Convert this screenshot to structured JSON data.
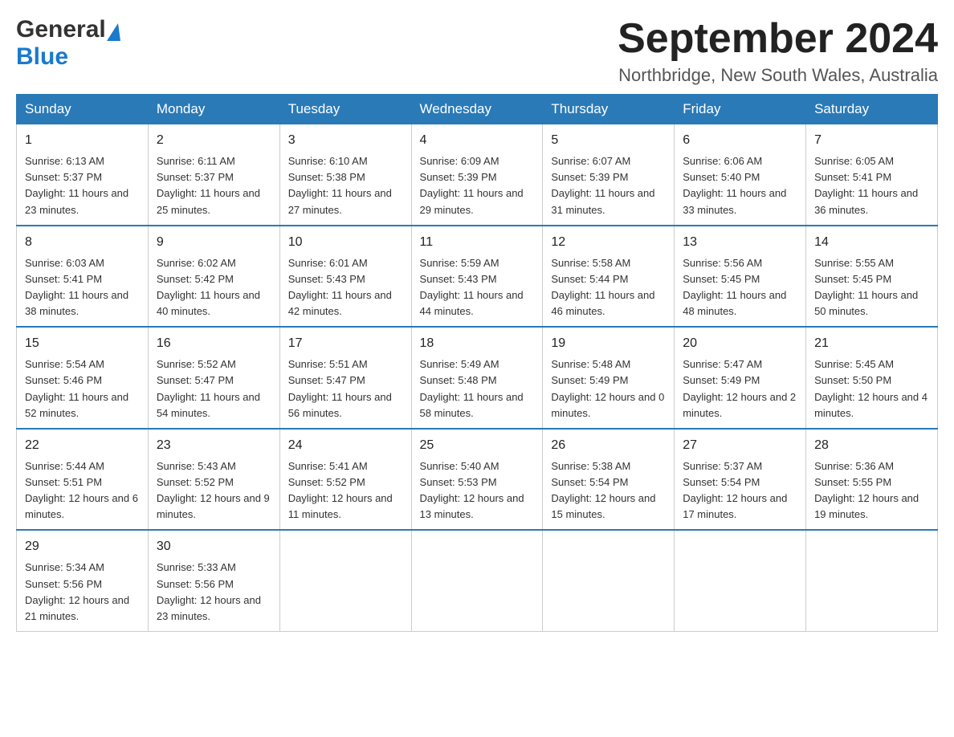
{
  "header": {
    "logo_general": "General",
    "logo_blue": "Blue",
    "month_title": "September 2024",
    "location": "Northbridge, New South Wales, Australia"
  },
  "days_of_week": [
    "Sunday",
    "Monday",
    "Tuesday",
    "Wednesday",
    "Thursday",
    "Friday",
    "Saturday"
  ],
  "weeks": [
    [
      {
        "day": "1",
        "sunrise": "Sunrise: 6:13 AM",
        "sunset": "Sunset: 5:37 PM",
        "daylight": "Daylight: 11 hours and 23 minutes."
      },
      {
        "day": "2",
        "sunrise": "Sunrise: 6:11 AM",
        "sunset": "Sunset: 5:37 PM",
        "daylight": "Daylight: 11 hours and 25 minutes."
      },
      {
        "day": "3",
        "sunrise": "Sunrise: 6:10 AM",
        "sunset": "Sunset: 5:38 PM",
        "daylight": "Daylight: 11 hours and 27 minutes."
      },
      {
        "day": "4",
        "sunrise": "Sunrise: 6:09 AM",
        "sunset": "Sunset: 5:39 PM",
        "daylight": "Daylight: 11 hours and 29 minutes."
      },
      {
        "day": "5",
        "sunrise": "Sunrise: 6:07 AM",
        "sunset": "Sunset: 5:39 PM",
        "daylight": "Daylight: 11 hours and 31 minutes."
      },
      {
        "day": "6",
        "sunrise": "Sunrise: 6:06 AM",
        "sunset": "Sunset: 5:40 PM",
        "daylight": "Daylight: 11 hours and 33 minutes."
      },
      {
        "day": "7",
        "sunrise": "Sunrise: 6:05 AM",
        "sunset": "Sunset: 5:41 PM",
        "daylight": "Daylight: 11 hours and 36 minutes."
      }
    ],
    [
      {
        "day": "8",
        "sunrise": "Sunrise: 6:03 AM",
        "sunset": "Sunset: 5:41 PM",
        "daylight": "Daylight: 11 hours and 38 minutes."
      },
      {
        "day": "9",
        "sunrise": "Sunrise: 6:02 AM",
        "sunset": "Sunset: 5:42 PM",
        "daylight": "Daylight: 11 hours and 40 minutes."
      },
      {
        "day": "10",
        "sunrise": "Sunrise: 6:01 AM",
        "sunset": "Sunset: 5:43 PM",
        "daylight": "Daylight: 11 hours and 42 minutes."
      },
      {
        "day": "11",
        "sunrise": "Sunrise: 5:59 AM",
        "sunset": "Sunset: 5:43 PM",
        "daylight": "Daylight: 11 hours and 44 minutes."
      },
      {
        "day": "12",
        "sunrise": "Sunrise: 5:58 AM",
        "sunset": "Sunset: 5:44 PM",
        "daylight": "Daylight: 11 hours and 46 minutes."
      },
      {
        "day": "13",
        "sunrise": "Sunrise: 5:56 AM",
        "sunset": "Sunset: 5:45 PM",
        "daylight": "Daylight: 11 hours and 48 minutes."
      },
      {
        "day": "14",
        "sunrise": "Sunrise: 5:55 AM",
        "sunset": "Sunset: 5:45 PM",
        "daylight": "Daylight: 11 hours and 50 minutes."
      }
    ],
    [
      {
        "day": "15",
        "sunrise": "Sunrise: 5:54 AM",
        "sunset": "Sunset: 5:46 PM",
        "daylight": "Daylight: 11 hours and 52 minutes."
      },
      {
        "day": "16",
        "sunrise": "Sunrise: 5:52 AM",
        "sunset": "Sunset: 5:47 PM",
        "daylight": "Daylight: 11 hours and 54 minutes."
      },
      {
        "day": "17",
        "sunrise": "Sunrise: 5:51 AM",
        "sunset": "Sunset: 5:47 PM",
        "daylight": "Daylight: 11 hours and 56 minutes."
      },
      {
        "day": "18",
        "sunrise": "Sunrise: 5:49 AM",
        "sunset": "Sunset: 5:48 PM",
        "daylight": "Daylight: 11 hours and 58 minutes."
      },
      {
        "day": "19",
        "sunrise": "Sunrise: 5:48 AM",
        "sunset": "Sunset: 5:49 PM",
        "daylight": "Daylight: 12 hours and 0 minutes."
      },
      {
        "day": "20",
        "sunrise": "Sunrise: 5:47 AM",
        "sunset": "Sunset: 5:49 PM",
        "daylight": "Daylight: 12 hours and 2 minutes."
      },
      {
        "day": "21",
        "sunrise": "Sunrise: 5:45 AM",
        "sunset": "Sunset: 5:50 PM",
        "daylight": "Daylight: 12 hours and 4 minutes."
      }
    ],
    [
      {
        "day": "22",
        "sunrise": "Sunrise: 5:44 AM",
        "sunset": "Sunset: 5:51 PM",
        "daylight": "Daylight: 12 hours and 6 minutes."
      },
      {
        "day": "23",
        "sunrise": "Sunrise: 5:43 AM",
        "sunset": "Sunset: 5:52 PM",
        "daylight": "Daylight: 12 hours and 9 minutes."
      },
      {
        "day": "24",
        "sunrise": "Sunrise: 5:41 AM",
        "sunset": "Sunset: 5:52 PM",
        "daylight": "Daylight: 12 hours and 11 minutes."
      },
      {
        "day": "25",
        "sunrise": "Sunrise: 5:40 AM",
        "sunset": "Sunset: 5:53 PM",
        "daylight": "Daylight: 12 hours and 13 minutes."
      },
      {
        "day": "26",
        "sunrise": "Sunrise: 5:38 AM",
        "sunset": "Sunset: 5:54 PM",
        "daylight": "Daylight: 12 hours and 15 minutes."
      },
      {
        "day": "27",
        "sunrise": "Sunrise: 5:37 AM",
        "sunset": "Sunset: 5:54 PM",
        "daylight": "Daylight: 12 hours and 17 minutes."
      },
      {
        "day": "28",
        "sunrise": "Sunrise: 5:36 AM",
        "sunset": "Sunset: 5:55 PM",
        "daylight": "Daylight: 12 hours and 19 minutes."
      }
    ],
    [
      {
        "day": "29",
        "sunrise": "Sunrise: 5:34 AM",
        "sunset": "Sunset: 5:56 PM",
        "daylight": "Daylight: 12 hours and 21 minutes."
      },
      {
        "day": "30",
        "sunrise": "Sunrise: 5:33 AM",
        "sunset": "Sunset: 5:56 PM",
        "daylight": "Daylight: 12 hours and 23 minutes."
      },
      null,
      null,
      null,
      null,
      null
    ]
  ]
}
